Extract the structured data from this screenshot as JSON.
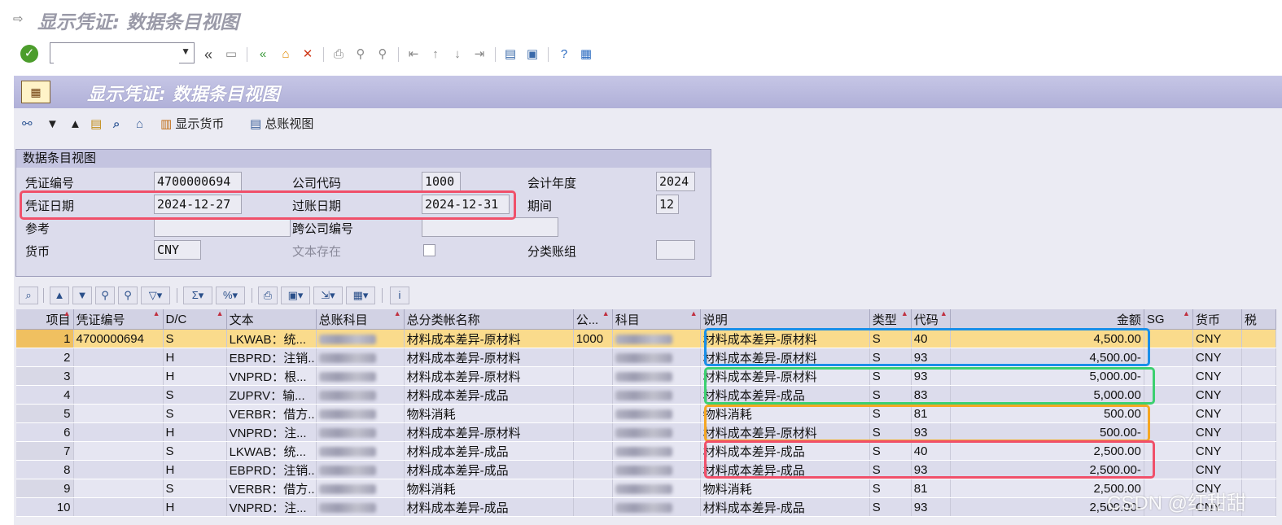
{
  "window": {
    "title": "显示凭证: 数据条目视图"
  },
  "screen": {
    "title": "显示凭证: 数据条目视图"
  },
  "command_field": {
    "value": ""
  },
  "toolbar": {
    "display_currency_label": "显示货币",
    "gl_view_label": "总账视图"
  },
  "header": {
    "caption": "数据条目视图",
    "doc_no": {
      "label": "凭证编号",
      "value": "4700000694"
    },
    "company_code": {
      "label": "公司代码",
      "value": "1000"
    },
    "fiscal_year": {
      "label": "会计年度",
      "value": "2024"
    },
    "doc_date": {
      "label": "凭证日期",
      "value": "2024-12-27"
    },
    "posting_date": {
      "label": "过账日期",
      "value": "2024-12-31"
    },
    "period": {
      "label": "期间",
      "value": "12"
    },
    "reference": {
      "label": "参考",
      "value": ""
    },
    "cross_company": {
      "label": "跨公司编号",
      "value": ""
    },
    "currency": {
      "label": "货币",
      "value": "CNY"
    },
    "text_exists": {
      "label": "文本存在"
    },
    "ledger_group": {
      "label": "分类账组",
      "value": ""
    }
  },
  "grid": {
    "columns": [
      "项目",
      "凭证编号",
      "D/C",
      "文本",
      "总账科目",
      "总分类帐名称",
      "公...",
      "科目",
      "说明",
      "类型",
      "代码",
      "金额",
      "SG",
      "货币",
      "税"
    ],
    "rows": [
      {
        "item": "1",
        "doc": "4700000694",
        "dc": "S",
        "text": "LKWAB：统...",
        "gl_name": "材料成本差异-原材料",
        "cc": "1000",
        "desc": "材料成本差异-原材料",
        "type": "S",
        "code": "40",
        "amount": "4,500.00",
        "cur": "CNY"
      },
      {
        "item": "2",
        "doc": "",
        "dc": "H",
        "text": "EBPRD：注销...",
        "gl_name": "材料成本差异-原材料",
        "cc": "",
        "desc": "材料成本差异-原材料",
        "type": "S",
        "code": "93",
        "amount": "4,500.00-",
        "cur": "CNY"
      },
      {
        "item": "3",
        "doc": "",
        "dc": "H",
        "text": "VNPRD：根...",
        "gl_name": "材料成本差异-原材料",
        "cc": "",
        "desc": "材料成本差异-原材料",
        "type": "S",
        "code": "93",
        "amount": "5,000.00-",
        "cur": "CNY"
      },
      {
        "item": "4",
        "doc": "",
        "dc": "S",
        "text": "ZUPRV：输...",
        "gl_name": "材料成本差异-成品",
        "cc": "",
        "desc": "材料成本差异-成品",
        "type": "S",
        "code": "83",
        "amount": "5,000.00",
        "cur": "CNY"
      },
      {
        "item": "5",
        "doc": "",
        "dc": "S",
        "text": "VERBR：借方...",
        "gl_name": "物料消耗",
        "cc": "",
        "desc": "物料消耗",
        "type": "S",
        "code": "81",
        "amount": "500.00",
        "cur": "CNY"
      },
      {
        "item": "6",
        "doc": "",
        "dc": "H",
        "text": "VNPRD：注...",
        "gl_name": "材料成本差异-原材料",
        "cc": "",
        "desc": "材料成本差异-原材料",
        "type": "S",
        "code": "93",
        "amount": "500.00-",
        "cur": "CNY"
      },
      {
        "item": "7",
        "doc": "",
        "dc": "S",
        "text": "LKWAB：统...",
        "gl_name": "材料成本差异-成品",
        "cc": "",
        "desc": "材料成本差异-成品",
        "type": "S",
        "code": "40",
        "amount": "2,500.00",
        "cur": "CNY"
      },
      {
        "item": "8",
        "doc": "",
        "dc": "H",
        "text": "EBPRD：注销...",
        "gl_name": "材料成本差异-成品",
        "cc": "",
        "desc": "材料成本差异-成品",
        "type": "S",
        "code": "93",
        "amount": "2,500.00-",
        "cur": "CNY"
      },
      {
        "item": "9",
        "doc": "",
        "dc": "S",
        "text": "VERBR：借方...",
        "gl_name": "物料消耗",
        "cc": "",
        "desc": "物料消耗",
        "type": "S",
        "code": "81",
        "amount": "2,500.00",
        "cur": "CNY"
      },
      {
        "item": "10",
        "doc": "",
        "dc": "H",
        "text": "VNPRD：注...",
        "gl_name": "材料成本差异-成品",
        "cc": "",
        "desc": "材料成本差异-成品",
        "type": "S",
        "code": "93",
        "amount": "2,500.00-",
        "cur": "CNY"
      }
    ]
  },
  "highlight_colors": {
    "red": "#f0506a",
    "blue": "#1a8fe8",
    "green": "#3cd070",
    "orange": "#f5a623"
  },
  "watermark": "CSDN @红甜甜"
}
